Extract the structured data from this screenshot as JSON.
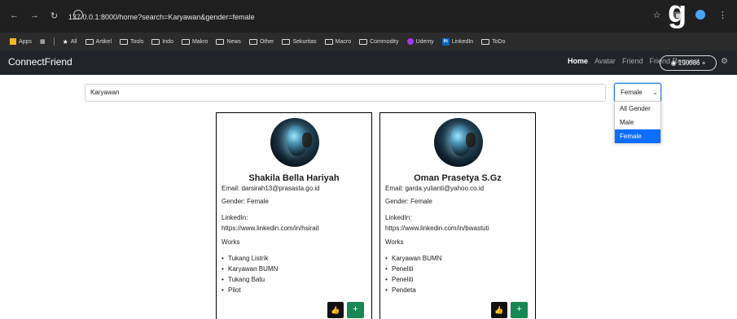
{
  "browser": {
    "url": "127.0.0.1:8000/home?search=Karyawan&gender=female",
    "bookmarks": [
      "Apps",
      "All",
      "Artikel",
      "Tools",
      "Indo",
      "Makro",
      "News",
      "Other",
      "Sekuritas",
      "Macro",
      "Commodity",
      "Udemy",
      "LinkedIn",
      "ToDo"
    ],
    "icons": [
      "back-arrow-icon",
      "forward-arrow-icon",
      "reload-icon",
      "site-info-icon",
      "star-icon",
      "extension-icon",
      "profile-icon"
    ]
  },
  "app": {
    "brand": "ConnectFriend",
    "nav": [
      "Home",
      "Avatar",
      "Friend",
      "Friend Request"
    ],
    "coins": "190086 +",
    "colors": {
      "navbar": "#212529",
      "selected": "#0d6efd",
      "add_button": "#198754"
    }
  },
  "search": {
    "value": "Karyawan",
    "selected_gender": "Female",
    "options": [
      "All Gender",
      "Male",
      "Female"
    ]
  },
  "cards": [
    {
      "name": "Shakila Bella Hariyah",
      "email": "Email: darsirah13@prasasta.go.id",
      "gender": "Gender: Female",
      "linkedin_label": "LinkedIn:",
      "linkedin_url": "https://www.linkedin.com/in/hsirait",
      "works_label": "Works",
      "works": [
        "Tukang Listrik",
        "Karyawan BUMN",
        "Tukang Batu",
        "Pilot"
      ],
      "buttons": [
        "👍",
        "+"
      ]
    },
    {
      "name": "Oman Prasetya S.Gz",
      "email": "Email: garda.yulianti@yahoo.co.id",
      "gender": "Gender: Female",
      "linkedin_label": "LinkedIn:",
      "linkedin_url": "https://www.linkedin.com/in/bwastuti",
      "works_label": "Works",
      "works": [
        "Karyawan BUMN",
        "Peneliti",
        "Peneliti",
        "Pendeta"
      ],
      "buttons": [
        "👍",
        "+"
      ]
    }
  ]
}
